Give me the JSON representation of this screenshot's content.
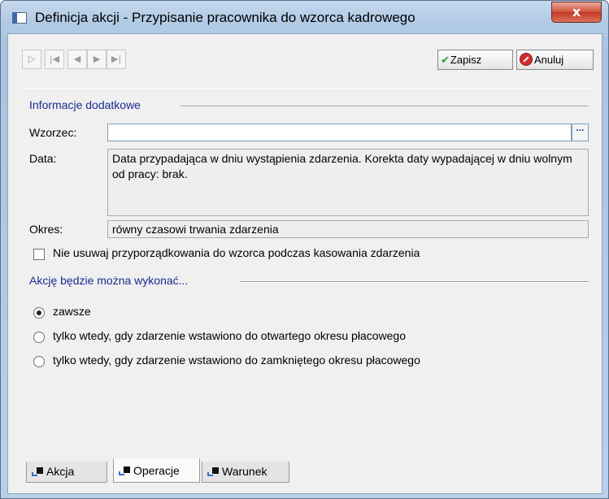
{
  "window": {
    "title": "Definicja akcji - Przypisanie pracownika do wzorca kadrowego",
    "close_label": "x"
  },
  "toolbar": {
    "nav": [
      {
        "name": "new-record-button",
        "glyph": "▷"
      },
      {
        "name": "first-record-button",
        "glyph": "|◀"
      },
      {
        "name": "prev-record-button",
        "glyph": "◀"
      },
      {
        "name": "next-record-button",
        "glyph": "▶"
      },
      {
        "name": "last-record-button",
        "glyph": "▶|"
      }
    ],
    "save_label": "Zapisz",
    "cancel_label": "Anuluj"
  },
  "info": {
    "group_title": "Informacje dodatkowe",
    "wzorzec_label": "Wzorzec:",
    "wzorzec_value": "",
    "ellipsis_label": "...",
    "data_label": "Data:",
    "data_value": "Data przypadająca w dniu wystąpienia zdarzenia. Korekta daty wypadającej w dniu wolnym od pracy: brak.",
    "okres_label": "Okres:",
    "okres_value": "równy czasowi trwania zdarzenia",
    "checkbox_label": "Nie usuwaj przyporządkowania do wzorca podczas kasowania zdarzenia",
    "checkbox_checked": false
  },
  "execution": {
    "group_title": "Akcję będzie można wykonać...",
    "options": [
      {
        "label": "zawsze",
        "checked": true
      },
      {
        "label": "tylko wtedy, gdy zdarzenie wstawiono do otwartego okresu płacowego",
        "checked": false
      },
      {
        "label": "tylko wtedy, gdy zdarzenie wstawiono do zamkniętego okresu płacowego",
        "checked": false
      }
    ]
  },
  "tabs": [
    {
      "label": "Akcja",
      "active": false
    },
    {
      "label": "Operacje",
      "active": true
    },
    {
      "label": "Warunek",
      "active": false
    }
  ],
  "colors": {
    "group_title": "#1a2a8c",
    "close_button": "#c23a23",
    "save_check": "#2e9a2e"
  }
}
